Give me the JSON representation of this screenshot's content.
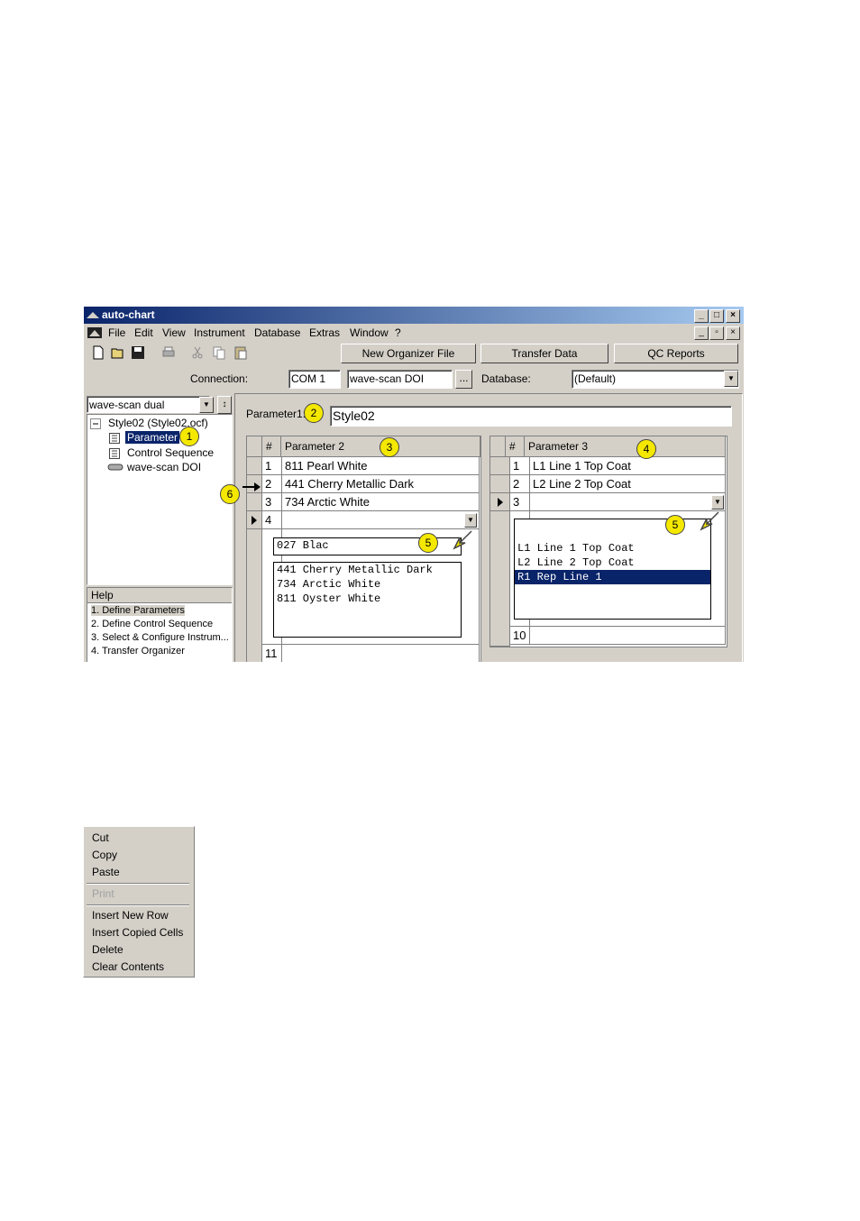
{
  "window": {
    "title": "auto-chart",
    "controls": [
      "_",
      "□",
      "×"
    ],
    "mdi_controls": [
      "_",
      "▫",
      "×"
    ]
  },
  "menubar": {
    "items": [
      "File",
      "Edit",
      "View",
      "Instrument",
      "Database",
      "Extras",
      "Window",
      "?"
    ]
  },
  "toolbar": {
    "icons": [
      "new-icon",
      "open-icon",
      "save-icon",
      "print-icon",
      "cut-icon",
      "copy-icon",
      "paste-icon"
    ],
    "new_organizer_label": "New Organizer File",
    "transfer_label": "Transfer Data",
    "qc_label": "QC Reports"
  },
  "connection": {
    "label": "Connection:",
    "port": "COM 1",
    "device": "wave-scan DOI",
    "browse": "...",
    "database_label": "Database:",
    "database_value": "(Default)"
  },
  "sidebar": {
    "instrument_select": "wave-scan dual",
    "tree_root": "Style02  (Style02.ocf)",
    "tree_items": [
      "Parameter",
      "Control Sequence",
      "wave-scan DOI"
    ],
    "help_title": "Help",
    "help_items": [
      "1. Define Parameters",
      "2. Define Control Sequence",
      "3. Select & Configure Instrum...",
      "4. Transfer Organizer"
    ]
  },
  "parameter1": {
    "label": "Parameter1:",
    "value": "Style02"
  },
  "grid2": {
    "col_num": "#",
    "col_title": "Parameter 2",
    "rows": [
      {
        "n": "1",
        "v": "811 Pearl White"
      },
      {
        "n": "2",
        "v": "441 Cherry Metallic Dark"
      },
      {
        "n": "3",
        "v": "734 Arctic White"
      },
      {
        "n": "4",
        "v": ""
      }
    ],
    "last_row": "11",
    "edit_text": "027 Blac",
    "dropdown": [
      "441 Cherry Metallic Dark",
      "734 Arctic White",
      "811 Oyster White"
    ]
  },
  "grid3": {
    "col_num": "#",
    "col_title": "Parameter 3",
    "rows": [
      {
        "n": "1",
        "v": "L1 Line 1 Top Coat"
      },
      {
        "n": "2",
        "v": "L2 Line 2 Top Coat"
      },
      {
        "n": "3",
        "v": ""
      }
    ],
    "last_row": "10",
    "dropdown": [
      "L1 Line 1 Top Coat",
      "L2 Line 2 Top Coat",
      "R1 Rep Line 1"
    ]
  },
  "callouts": [
    "1",
    "2",
    "3",
    "4",
    "5",
    "5",
    "6"
  ],
  "context_menu": {
    "items": [
      "Cut",
      "Copy",
      "Paste",
      "Print",
      "Insert New Row",
      "Insert Copied Cells",
      "Delete",
      "Clear Contents"
    ]
  }
}
